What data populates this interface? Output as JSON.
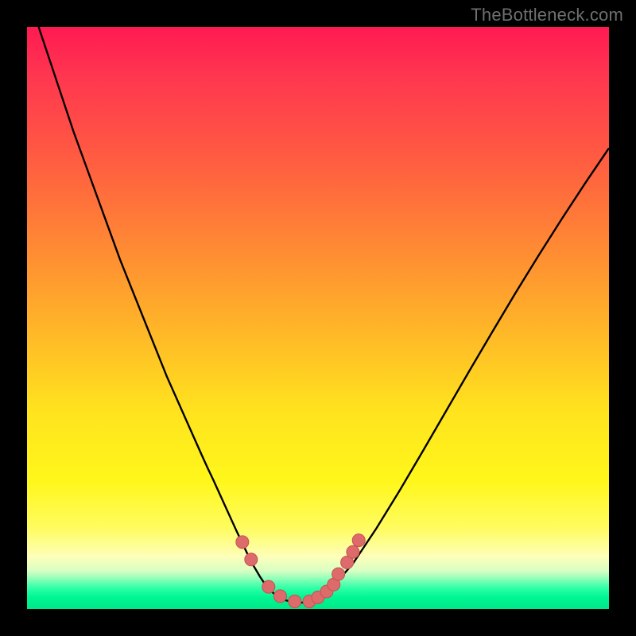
{
  "watermark": "TheBottleneck.com",
  "colors": {
    "frame": "#000000",
    "curve": "#000000",
    "marker_fill": "#dd6b6b",
    "marker_stroke": "#c94f4f",
    "gradient_top": "#ff1a52",
    "gradient_bottom": "#00e887"
  },
  "chart_data": {
    "type": "line",
    "title": "",
    "xlabel": "",
    "ylabel": "",
    "xlim": [
      0,
      100
    ],
    "ylim": [
      0,
      100
    ],
    "grid": false,
    "legend": false,
    "annotations": [],
    "series": [
      {
        "name": "curve",
        "x": [
          2,
          4,
          6,
          8,
          10,
          12,
          14,
          16,
          18,
          20,
          22,
          24,
          26,
          28,
          30,
          31,
          32,
          33,
          34,
          35,
          36,
          37,
          38,
          39,
          40,
          41,
          42,
          43,
          44,
          46,
          48,
          50,
          52,
          56,
          60,
          64,
          68,
          72,
          76,
          80,
          84,
          88,
          92,
          96,
          100
        ],
        "y": [
          100,
          94,
          88,
          82,
          76.5,
          71,
          65.5,
          60,
          55,
          50,
          45,
          40,
          35.5,
          31,
          26.5,
          24.3,
          22.2,
          20,
          17.8,
          15.6,
          13.4,
          11.3,
          9.2,
          7.3,
          5.6,
          4.1,
          3.0,
          2.2,
          1.6,
          1.1,
          1.1,
          1.8,
          3.2,
          7.8,
          13.8,
          20.3,
          27.1,
          34.0,
          40.9,
          47.7,
          54.4,
          60.9,
          67.2,
          73.3,
          79.2
        ]
      }
    ],
    "markers": [
      {
        "x": 37.0,
        "y": 11.5
      },
      {
        "x": 38.5,
        "y": 8.5
      },
      {
        "x": 41.5,
        "y": 3.8
      },
      {
        "x": 43.5,
        "y": 2.2
      },
      {
        "x": 46.0,
        "y": 1.3
      },
      {
        "x": 48.5,
        "y": 1.3
      },
      {
        "x": 50.0,
        "y": 2.0
      },
      {
        "x": 51.5,
        "y": 3.0
      },
      {
        "x": 52.7,
        "y": 4.2
      },
      {
        "x": 53.5,
        "y": 6.0
      },
      {
        "x": 55.0,
        "y": 8.0
      },
      {
        "x": 56.0,
        "y": 9.8
      },
      {
        "x": 57.0,
        "y": 11.8
      }
    ]
  }
}
